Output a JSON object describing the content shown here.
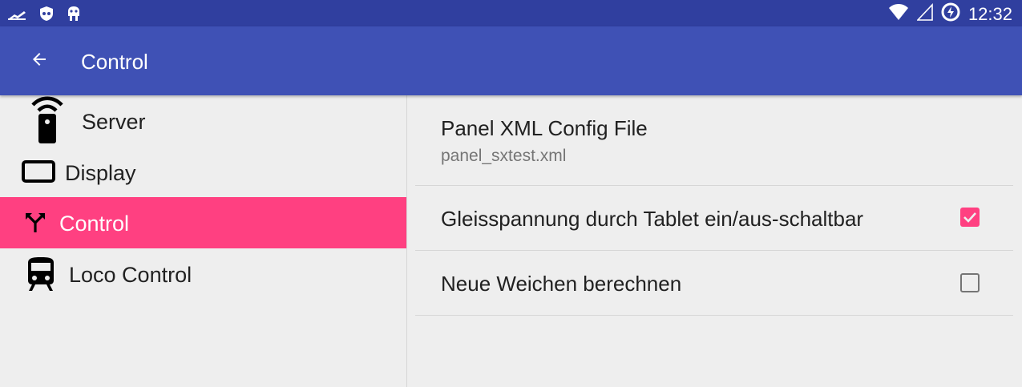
{
  "status_bar": {
    "time": "12:32",
    "left_icons": [
      "signal-strength-icon",
      "shield-icon",
      "android-debug-icon"
    ],
    "right_icons": [
      "wifi-icon",
      "cellular-signal-icon",
      "battery-charging-icon"
    ]
  },
  "app_bar": {
    "title": "Control",
    "back_icon": "arrow-back-icon",
    "color": "#3f51b5",
    "status_color": "#303f9f"
  },
  "sidebar": {
    "items": [
      {
        "label": "Server",
        "icon": "remote-wifi-icon",
        "active": false
      },
      {
        "label": "Display",
        "icon": "tablet-icon",
        "active": false
      },
      {
        "label": "Control",
        "icon": "call-split-icon",
        "active": true
      },
      {
        "label": "Loco Control",
        "icon": "train-icon",
        "active": false
      }
    ],
    "active_color": "#ff4081"
  },
  "preferences": [
    {
      "title": "Panel XML Config File",
      "summary": "panel_sxtest.xml"
    },
    {
      "title": "Gleisspannung durch Tablet ein/aus-schaltbar",
      "checked": true
    },
    {
      "title": "Neue Weichen berechnen",
      "checked": false
    }
  ]
}
